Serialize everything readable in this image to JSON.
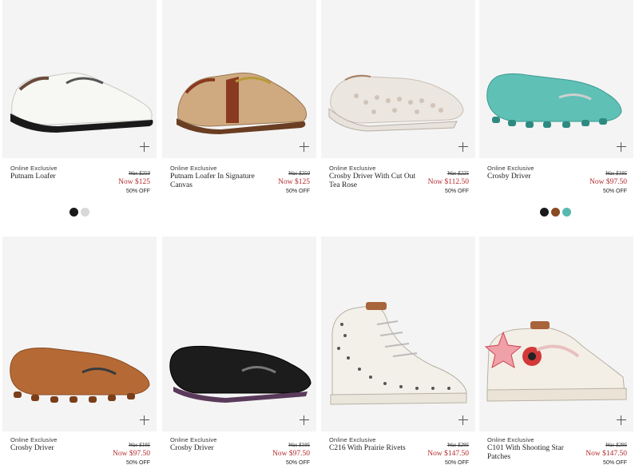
{
  "products": [
    {
      "badge": "Online Exclusive",
      "name": "Putnam Loafer",
      "was": "Was $250",
      "now": "Now $125",
      "off": "50% OFF",
      "image": "white-loafer-icon",
      "swatches": [
        "#1a1a1a",
        "#d8d8d8"
      ]
    },
    {
      "badge": "Online Exclusive",
      "name": "Putnam Loafer In Signature Canvas",
      "was": "Was $250",
      "now": "Now $125",
      "off": "50% OFF",
      "image": "signature-canvas-loafer-icon",
      "swatches": []
    },
    {
      "badge": "Online Exclusive",
      "name": "Crosby Driver With Cut Out Tea Rose",
      "was": "Was $225",
      "now": "Now $112.50",
      "off": "50% OFF",
      "image": "cutout-driver-icon",
      "swatches": []
    },
    {
      "badge": "Online Exclusive",
      "name": "Crosby Driver",
      "was": "Was $195",
      "now": "Now $97.50",
      "off": "50% OFF",
      "image": "teal-driver-icon",
      "swatches": [
        "#1a1a1a",
        "#8a4a22",
        "#58b8b0"
      ]
    },
    {
      "badge": "Online Exclusive",
      "name": "Crosby Driver",
      "was": "Was $195",
      "now": "Now $97.50",
      "off": "50% OFF",
      "image": "tan-driver-icon",
      "swatches": []
    },
    {
      "badge": "Online Exclusive",
      "name": "Crosby Driver",
      "was": "Was $195",
      "now": "Now $97.50",
      "off": "50% OFF",
      "image": "black-driver-icon",
      "swatches": []
    },
    {
      "badge": "Online Exclusive",
      "name": "C216 With Prairie Rivets",
      "was": "Was $295",
      "now": "Now $147.50",
      "off": "50% OFF",
      "image": "high-top-sneaker-icon",
      "swatches": []
    },
    {
      "badge": "Online Exclusive",
      "name": "C101 With Shooting Star Patches",
      "was": "Was $295",
      "now": "Now $147.50",
      "off": "50% OFF",
      "image": "patch-sneaker-icon",
      "swatches": []
    }
  ],
  "colors": {
    "sale_red": "#b3282d",
    "tile_bg": "#f4f4f4"
  }
}
